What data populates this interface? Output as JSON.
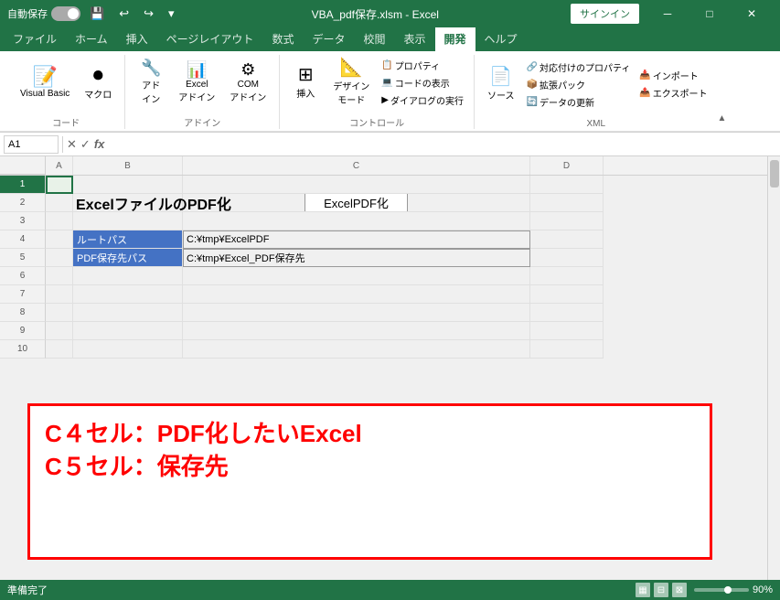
{
  "titleBar": {
    "autosave": "自動保存",
    "filename": "VBA_pdf保存.xlsm - Excel",
    "signin": "サインイン",
    "undoIcon": "↩",
    "redoIcon": "↪",
    "saveIcon": "💾",
    "minIcon": "─",
    "maxIcon": "□",
    "closeIcon": "✕"
  },
  "ribbonTabs": [
    {
      "label": "ファイル",
      "active": false
    },
    {
      "label": "ホーム",
      "active": false
    },
    {
      "label": "挿入",
      "active": false
    },
    {
      "label": "ページレイアウト",
      "active": false
    },
    {
      "label": "数式",
      "active": false
    },
    {
      "label": "データ",
      "active": false
    },
    {
      "label": "校閲",
      "active": false
    },
    {
      "label": "表示",
      "active": false
    },
    {
      "label": "開発",
      "active": true
    },
    {
      "label": "ヘルプ",
      "active": false
    }
  ],
  "ribbonGroups": {
    "code": {
      "label": "コード",
      "buttons": [
        {
          "id": "visual-basic",
          "icon": "📝",
          "label": "Visual Basic"
        },
        {
          "id": "macro",
          "icon": "⏺",
          "label": "マクロ"
        }
      ]
    },
    "addin": {
      "label": "アドイン",
      "buttons": [
        {
          "id": "adin",
          "icon": "🔧",
          "label": "アド\nイン"
        },
        {
          "id": "excel-addin",
          "icon": "📊",
          "label": "Excel\nアドイン"
        },
        {
          "id": "com-addin",
          "icon": "⚙",
          "label": "COM\nアドイン"
        }
      ]
    },
    "control": {
      "label": "コントロール",
      "buttons": [
        {
          "id": "insert-ctrl",
          "icon": "⊞",
          "label": "挿入"
        },
        {
          "id": "design-mode",
          "icon": "📐",
          "label": "デザイン\nモード"
        }
      ],
      "smallButtons": [
        {
          "id": "properties",
          "label": "プロパティ"
        },
        {
          "id": "code-view",
          "label": "コードの表示"
        },
        {
          "id": "dialog-run",
          "label": "ダイアログの実行"
        }
      ]
    },
    "xml": {
      "label": "XML",
      "buttons": [
        {
          "id": "source",
          "icon": "📄",
          "label": "ソース"
        }
      ],
      "smallButtons": [
        {
          "id": "map-props",
          "label": "対応付けのプロパティ"
        },
        {
          "id": "expand-pack",
          "label": "拡張パック"
        },
        {
          "id": "data-update",
          "label": "データの更新"
        },
        {
          "id": "import",
          "label": "インポート"
        },
        {
          "id": "export",
          "label": "エクスポート"
        }
      ]
    }
  },
  "formulaBar": {
    "cellRef": "A1",
    "cancelIcon": "✕",
    "confirmIcon": "✓",
    "formulaIcon": "fx"
  },
  "grid": {
    "colHeaders": [
      "A",
      "B",
      "C",
      "D"
    ],
    "rows": [
      {
        "num": 1,
        "cells": [
          "",
          "",
          "",
          ""
        ]
      },
      {
        "num": 2,
        "cells": [
          "",
          "ExcelファイルのPDF化",
          "",
          ""
        ]
      },
      {
        "num": 3,
        "cells": [
          "",
          "",
          "",
          ""
        ]
      },
      {
        "num": 4,
        "cells": [
          "",
          "ルートパス",
          "C:¥tmp¥ExcelPDF",
          ""
        ]
      },
      {
        "num": 5,
        "cells": [
          "",
          "PDF保存先パス",
          "C:¥tmp¥Excel_PDF保存先",
          ""
        ]
      },
      {
        "num": 6,
        "cells": [
          "",
          "",
          "",
          ""
        ]
      },
      {
        "num": 7,
        "cells": [
          "",
          "",
          "",
          ""
        ]
      },
      {
        "num": 8,
        "cells": [
          "",
          "",
          "",
          ""
        ]
      },
      {
        "num": 9,
        "cells": [
          "",
          "",
          "",
          ""
        ]
      },
      {
        "num": 10,
        "cells": [
          "",
          "",
          "",
          ""
        ]
      }
    ]
  },
  "excelButton": "ExcelPDF化",
  "annotation": {
    "line1": "C４セル：PDF化したいExcel",
    "line2": "C５セル：保存先"
  },
  "statusBar": {
    "status": "準備完了",
    "zoom": "90%"
  }
}
